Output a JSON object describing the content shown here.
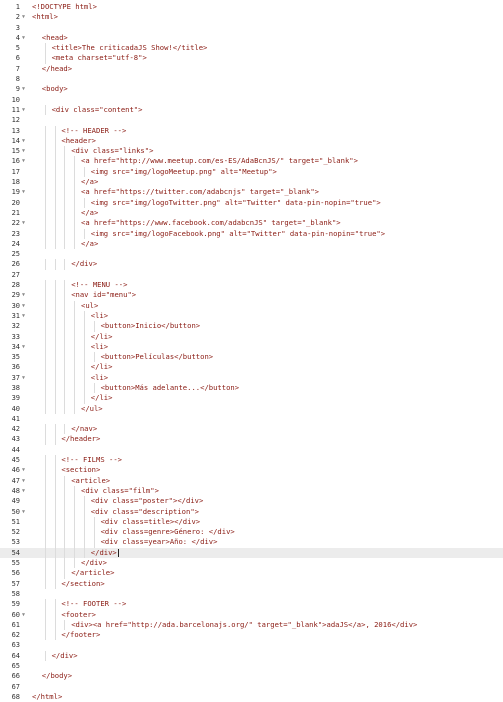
{
  "editor": {
    "active_line": 54,
    "lines": [
      {
        "n": "1",
        "fold": false,
        "indent": 0,
        "text": "<!DOCTYPE html>"
      },
      {
        "n": "2",
        "fold": true,
        "indent": 0,
        "text": "<html>"
      },
      {
        "n": "3",
        "fold": false,
        "indent": 0,
        "text": ""
      },
      {
        "n": "4",
        "fold": true,
        "indent": 1,
        "text": "<head>"
      },
      {
        "n": "5",
        "fold": false,
        "indent": 2,
        "text": "<title>The criticadaJS Show!</title>"
      },
      {
        "n": "6",
        "fold": false,
        "indent": 2,
        "text": "<meta charset=\"utf-8\">"
      },
      {
        "n": "7",
        "fold": false,
        "indent": 1,
        "text": "</head>"
      },
      {
        "n": "8",
        "fold": false,
        "indent": 0,
        "text": ""
      },
      {
        "n": "9",
        "fold": true,
        "indent": 1,
        "text": "<body>"
      },
      {
        "n": "10",
        "fold": false,
        "indent": 0,
        "text": ""
      },
      {
        "n": "11",
        "fold": true,
        "indent": 2,
        "text": "<div class=\"content\">"
      },
      {
        "n": "12",
        "fold": false,
        "indent": 0,
        "text": ""
      },
      {
        "n": "13",
        "fold": false,
        "indent": 3,
        "text": "<!-- HEADER -->"
      },
      {
        "n": "14",
        "fold": true,
        "indent": 3,
        "text": "<header>"
      },
      {
        "n": "15",
        "fold": true,
        "indent": 4,
        "text": "<div class=\"links\">"
      },
      {
        "n": "16",
        "fold": true,
        "indent": 5,
        "text": "<a href=\"http://www.meetup.com/es-ES/AdaBcnJS/\" target=\"_blank\">"
      },
      {
        "n": "17",
        "fold": false,
        "indent": 6,
        "text": "<img src=\"img/logoMeetup.png\" alt=\"Meetup\">"
      },
      {
        "n": "18",
        "fold": false,
        "indent": 5,
        "text": "</a>"
      },
      {
        "n": "19",
        "fold": true,
        "indent": 5,
        "text": "<a href=\"https://twitter.com/adabcnjs\" target=\"_blank\">"
      },
      {
        "n": "20",
        "fold": false,
        "indent": 6,
        "text": "<img src=\"img/logoTwitter.png\" alt=\"Twitter\" data-pin-nopin=\"true\">"
      },
      {
        "n": "21",
        "fold": false,
        "indent": 5,
        "text": "</a>"
      },
      {
        "n": "22",
        "fold": true,
        "indent": 5,
        "text": "<a href=\"https://www.facebook.com/adabcnJS\" target=\"_blank\">"
      },
      {
        "n": "23",
        "fold": false,
        "indent": 6,
        "text": "<img src=\"img/logoFacebook.png\" alt=\"Twitter\" data-pin-nopin=\"true\">"
      },
      {
        "n": "24",
        "fold": false,
        "indent": 5,
        "text": "</a>"
      },
      {
        "n": "25",
        "fold": false,
        "indent": 0,
        "text": ""
      },
      {
        "n": "26",
        "fold": false,
        "indent": 4,
        "text": "</div>"
      },
      {
        "n": "27",
        "fold": false,
        "indent": 0,
        "text": ""
      },
      {
        "n": "28",
        "fold": false,
        "indent": 4,
        "text": "<!-- MENU -->"
      },
      {
        "n": "29",
        "fold": true,
        "indent": 4,
        "text": "<nav id=\"menu\">"
      },
      {
        "n": "30",
        "fold": true,
        "indent": 5,
        "text": "<ul>"
      },
      {
        "n": "31",
        "fold": true,
        "indent": 6,
        "text": "<li>"
      },
      {
        "n": "32",
        "fold": false,
        "indent": 7,
        "text": "<button>Inicio</button>"
      },
      {
        "n": "33",
        "fold": false,
        "indent": 6,
        "text": "</li>"
      },
      {
        "n": "34",
        "fold": true,
        "indent": 6,
        "text": "<li>"
      },
      {
        "n": "35",
        "fold": false,
        "indent": 7,
        "text": "<button>Películas</button>"
      },
      {
        "n": "36",
        "fold": false,
        "indent": 6,
        "text": "</li>"
      },
      {
        "n": "37",
        "fold": true,
        "indent": 6,
        "text": "<li>"
      },
      {
        "n": "38",
        "fold": false,
        "indent": 7,
        "text": "<button>Más adelante...</button>"
      },
      {
        "n": "39",
        "fold": false,
        "indent": 6,
        "text": "</li>"
      },
      {
        "n": "40",
        "fold": false,
        "indent": 5,
        "text": "</ul>"
      },
      {
        "n": "41",
        "fold": false,
        "indent": 0,
        "text": ""
      },
      {
        "n": "42",
        "fold": false,
        "indent": 4,
        "text": "</nav>"
      },
      {
        "n": "43",
        "fold": false,
        "indent": 3,
        "text": "</header>"
      },
      {
        "n": "44",
        "fold": false,
        "indent": 0,
        "text": ""
      },
      {
        "n": "45",
        "fold": false,
        "indent": 3,
        "text": "<!-- FILMS -->"
      },
      {
        "n": "46",
        "fold": true,
        "indent": 3,
        "text": "<section>"
      },
      {
        "n": "47",
        "fold": true,
        "indent": 4,
        "text": "<article>"
      },
      {
        "n": "48",
        "fold": true,
        "indent": 5,
        "text": "<div class=\"film\">"
      },
      {
        "n": "49",
        "fold": false,
        "indent": 6,
        "text": "<div class=\"poster\"></div>"
      },
      {
        "n": "50",
        "fold": true,
        "indent": 6,
        "text": "<div class=\"description\">"
      },
      {
        "n": "51",
        "fold": false,
        "indent": 7,
        "text": "<div class=title></div>"
      },
      {
        "n": "52",
        "fold": false,
        "indent": 7,
        "text": "<div class=genre>Género: </div>"
      },
      {
        "n": "53",
        "fold": false,
        "indent": 7,
        "text": "<div class=year>Año: </div>"
      },
      {
        "n": "54",
        "fold": false,
        "indent": 6,
        "text": "</div>"
      },
      {
        "n": "55",
        "fold": false,
        "indent": 5,
        "text": "</div>"
      },
      {
        "n": "56",
        "fold": false,
        "indent": 4,
        "text": "</article>"
      },
      {
        "n": "57",
        "fold": false,
        "indent": 3,
        "text": "</section>"
      },
      {
        "n": "58",
        "fold": false,
        "indent": 0,
        "text": ""
      },
      {
        "n": "59",
        "fold": false,
        "indent": 3,
        "text": "<!-- FOOTER -->"
      },
      {
        "n": "60",
        "fold": true,
        "indent": 3,
        "text": "<footer>"
      },
      {
        "n": "61",
        "fold": false,
        "indent": 4,
        "text": "<div><a href=\"http://ada.barcelonajs.org/\" target=\"_blank\">adaJS</a>, 2016</div>"
      },
      {
        "n": "62",
        "fold": false,
        "indent": 3,
        "text": "</footer>"
      },
      {
        "n": "63",
        "fold": false,
        "indent": 0,
        "text": ""
      },
      {
        "n": "64",
        "fold": false,
        "indent": 2,
        "text": "</div>"
      },
      {
        "n": "65",
        "fold": false,
        "indent": 0,
        "text": ""
      },
      {
        "n": "66",
        "fold": false,
        "indent": 1,
        "text": "</body>"
      },
      {
        "n": "67",
        "fold": false,
        "indent": 0,
        "text": ""
      },
      {
        "n": "68",
        "fold": false,
        "indent": 0,
        "text": "</html>"
      }
    ]
  }
}
